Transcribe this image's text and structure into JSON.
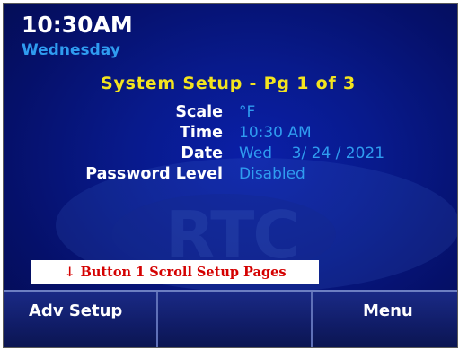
{
  "header": {
    "time": "10:30AM",
    "day": "Wednesday"
  },
  "screen": {
    "title": "System Setup - Pg 1 of 3",
    "rows": [
      {
        "label": "Scale",
        "value": "°F"
      },
      {
        "label": "Time",
        "value": "10:30 AM"
      },
      {
        "label": "Date",
        "value": "Wed    3/ 24 / 2021"
      },
      {
        "label": "Password Level",
        "value": "Disabled"
      }
    ]
  },
  "callout": {
    "arrow": "↓",
    "text": "Button 1 Scroll Setup Pages"
  },
  "softkeys": {
    "key1": "Adv Setup",
    "key2": "",
    "key3": "",
    "key4": "Menu"
  },
  "colors": {
    "background": "#081a8c",
    "title": "#f3e41e",
    "value": "#2f9cf0",
    "callout_text": "#d40000"
  }
}
